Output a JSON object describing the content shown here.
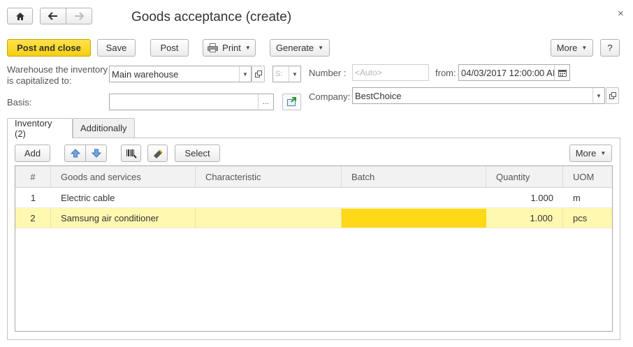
{
  "window": {
    "title": "Goods acceptance (create)",
    "home_icon": "home-icon",
    "back_icon": "arrow-left-icon",
    "forward_icon": "arrow-right-icon",
    "close_label": "×"
  },
  "toolbar": {
    "post_and_close": "Post and close",
    "save": "Save",
    "post": "Post",
    "print": "Print",
    "generate": "Generate",
    "more": "More",
    "help": "?"
  },
  "form": {
    "warehouse_label_line1": "Warehouse the inventory",
    "warehouse_label_line2": "is capitalized to:",
    "warehouse_value": "Main warehouse",
    "storage_value": "S:",
    "basis_label": "Basis:",
    "basis_value": "",
    "basis_button": "...",
    "number_label": "Number :",
    "number_placeholder": "<Auto>",
    "from_label": "from:",
    "date_value": "04/03/2017 12:00:00 AI",
    "company_label": "Company:",
    "company_value": "BestChoice"
  },
  "tabs": [
    {
      "label": "Inventory (2)",
      "active": true
    },
    {
      "label": "Additionally",
      "active": false
    }
  ],
  "grid_toolbar": {
    "add": "Add",
    "select": "Select",
    "more": "More"
  },
  "table": {
    "columns": [
      "#",
      "Goods and services",
      "Characteristic",
      "Batch",
      "Quantity",
      "UOM"
    ],
    "rows": [
      {
        "n": "1",
        "goods": "Electric cable",
        "characteristic": "",
        "batch": "",
        "quantity": "1.000",
        "uom": "m",
        "selected": false
      },
      {
        "n": "2",
        "goods": "Samsung air conditioner",
        "characteristic": "",
        "batch": "",
        "quantity": "1.000",
        "uom": "pcs",
        "selected": true
      }
    ]
  },
  "colors": {
    "primary_button": "#f5cf10",
    "selected_row": "#fff8b0",
    "active_cell": "#ffd817"
  }
}
